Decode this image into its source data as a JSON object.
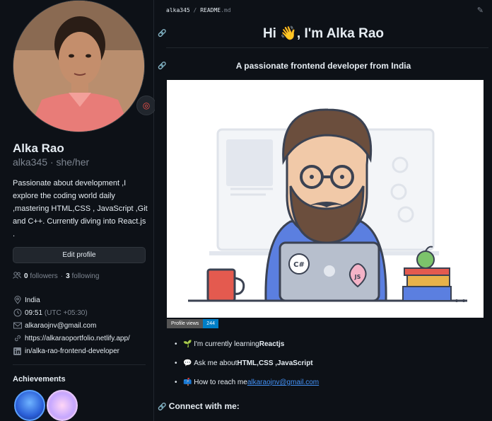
{
  "profile": {
    "name": "Alka Rao",
    "handle": "alka345",
    "pronouns": "she/her",
    "bio": "Passionate about development ,I explore the coding world daily ,mastering HTML,CSS , JavaScript ,Git and C++. Currently diving into React.js .",
    "edit_label": "Edit profile",
    "followers_count": "0",
    "followers_label": "followers",
    "following_count": "3",
    "following_label": "following",
    "location": "India",
    "time": "09:51",
    "timezone": "(UTC +05:30)",
    "email": "alkaraojnv@gmail.com",
    "website": "https://alkaraoportfolio.netlify.app/",
    "linkedin": "in/alka-rao-frontend-developer",
    "achievements_title": "Achievements"
  },
  "readme": {
    "owner": "alka345",
    "separator": "/",
    "file": "README",
    "ext": ".md",
    "title": "Hi 👋, I'm Alka Rao",
    "subtitle": "A passionate frontend developer from India",
    "views_label": "Profile views",
    "views_count": "244",
    "items": [
      {
        "emoji": "🌱",
        "prefix": "I'm currently learning ",
        "bold": "Reactjs"
      },
      {
        "emoji": "💬",
        "prefix": "Ask me about ",
        "bold": "HTML,CSS ,JavaScript"
      },
      {
        "emoji": "📫",
        "prefix": "How to reach me ",
        "link": "alkaraojnv@gmail.com"
      }
    ],
    "connect": "Connect with me:",
    "laptop_text_1": "C#",
    "laptop_text_2": "JS"
  },
  "colors": {
    "bg": "#0d1117",
    "border": "#30363d",
    "muted": "#7d8590",
    "link": "#4493f8",
    "views_badge": "#007ec6"
  }
}
